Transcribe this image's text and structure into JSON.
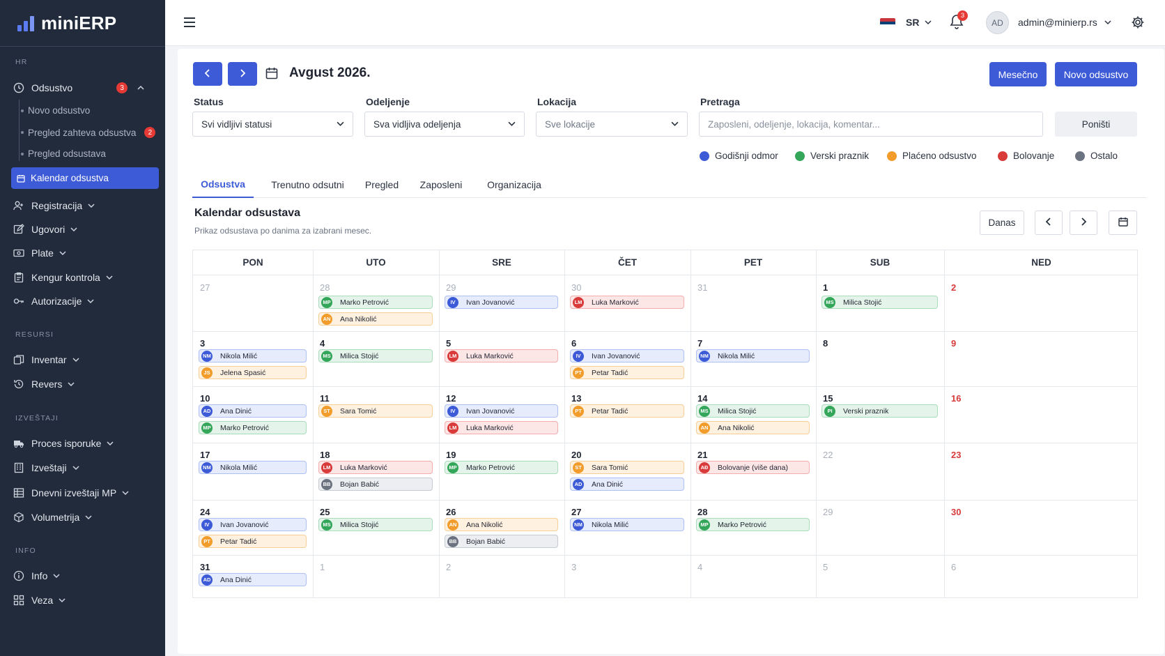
{
  "app": {
    "name": "miniERP"
  },
  "colors": {
    "accent": "#3d5ad7",
    "sidebar": "#222b3b",
    "blue": "#3d5ad7",
    "green": "#34a65a",
    "orange": "#f29d2b",
    "red": "#d93b3b",
    "gray": "#6c7380"
  },
  "sidebar": {
    "sections": {
      "hr": "HR",
      "resursi": "RESURSI",
      "izvestaji": "IZVEŠTAJI",
      "info": "INFO"
    },
    "odsustvo": {
      "label": "Odsustvo",
      "badge": "3"
    },
    "sub": {
      "novo": "Novo odsustvo",
      "pregled_zahteva": "Pregled zahteva odsustva",
      "pregled_zahteva_badge": "2",
      "pregled": "Pregled odsustava",
      "kalendar": "Kalendar odsustva"
    },
    "items": {
      "registracija": "Registracija",
      "ugovori": "Ugovori",
      "plate": "Plate",
      "kengur": "Kengur kontrola",
      "autorizacije": "Autorizacije",
      "inventar": "Inventar",
      "revers": "Revers",
      "proces": "Proces isporuke",
      "izvestaji": "Izveštaji",
      "dnevni": "Dnevni izveštaji MP",
      "volumetrija": "Volumetrija",
      "info": "Info",
      "veza": "Veza"
    }
  },
  "topbar": {
    "lang": "SR",
    "notifications": "3",
    "avatar": "AD",
    "user": "admin@minierp.rs"
  },
  "header": {
    "month": "Avgust 2026.",
    "monthly_btn": "Mesečno",
    "new_btn": "Novo odsustvo"
  },
  "filters": {
    "status": {
      "label": "Status",
      "value": "Svi vidljivi statusi"
    },
    "odeljenje": {
      "label": "Odeljenje",
      "value": "Sva vidljiva odeljenja"
    },
    "lokacija": {
      "label": "Lokacija",
      "value": "Sve lokacije"
    },
    "pretraga": {
      "label": "Pretraga",
      "placeholder": "Zaposleni, odeljenje, lokacija, komentar..."
    },
    "reset": "Poništi"
  },
  "legend": [
    {
      "label": "Godišnji odmor",
      "color": "#3d5ad7"
    },
    {
      "label": "Verski praznik",
      "color": "#34a65a"
    },
    {
      "label": "Plaćeno odsustvo",
      "color": "#f29d2b"
    },
    {
      "label": "Bolovanje",
      "color": "#d93b3b"
    },
    {
      "label": "Ostalo",
      "color": "#6c7380"
    }
  ],
  "tabs": [
    "Odsustva",
    "Trenutno odsutni",
    "Pregled",
    "Zaposleni",
    "Organizacija"
  ],
  "calendar": {
    "title": "Kalendar odsustava",
    "subtitle": "Prikaz odsustava po danima za izabrani mesec.",
    "today_btn": "Danas",
    "weekdays": [
      "PON",
      "UTO",
      "SRE",
      "ČET",
      "PET",
      "SUB",
      "NED"
    ],
    "weeks": [
      [
        {
          "day": "27",
          "muted": true,
          "events": []
        },
        {
          "day": "28",
          "muted": true,
          "events": [
            {
              "ini": "MP",
              "name": "Marko Petrović",
              "type": "green"
            },
            {
              "ini": "AN",
              "name": "Ana Nikolić",
              "type": "orange"
            }
          ]
        },
        {
          "day": "29",
          "muted": true,
          "events": [
            {
              "ini": "IV",
              "name": "Ivan Jovanović",
              "type": "blue"
            }
          ]
        },
        {
          "day": "30",
          "muted": true,
          "events": [
            {
              "ini": "LM",
              "name": "Luka Marković",
              "type": "red"
            }
          ]
        },
        {
          "day": "31",
          "muted": true,
          "events": []
        },
        {
          "day": "1",
          "muted": false,
          "events": [
            {
              "ini": "MS",
              "name": "Milica Stojić",
              "type": "green"
            }
          ]
        },
        {
          "day": "2",
          "muted": false,
          "sun": true,
          "events": []
        }
      ],
      [
        {
          "day": "3",
          "events": [
            {
              "ini": "NM",
              "name": "Nikola Milić",
              "type": "blue"
            },
            {
              "ini": "JS",
              "name": "Jelena Spasić",
              "type": "orange"
            }
          ]
        },
        {
          "day": "4",
          "events": [
            {
              "ini": "MS",
              "name": "Milica Stojić",
              "type": "green"
            }
          ]
        },
        {
          "day": "5",
          "events": [
            {
              "ini": "LM",
              "name": "Luka Marković",
              "type": "red"
            }
          ]
        },
        {
          "day": "6",
          "events": [
            {
              "ini": "IV",
              "name": "Ivan Jovanović",
              "type": "blue"
            },
            {
              "ini": "PT",
              "name": "Petar Tadić",
              "type": "orange"
            }
          ]
        },
        {
          "day": "7",
          "events": [
            {
              "ini": "NM",
              "name": "Nikola Milić",
              "type": "blue"
            }
          ]
        },
        {
          "day": "8",
          "events": []
        },
        {
          "day": "9",
          "sun": true,
          "events": []
        }
      ],
      [
        {
          "day": "10",
          "events": [
            {
              "ini": "AD",
              "name": "Ana Dinić",
              "type": "blue"
            },
            {
              "ini": "MP",
              "name": "Marko Petrović",
              "type": "green"
            }
          ]
        },
        {
          "day": "11",
          "events": [
            {
              "ini": "ST",
              "name": "Sara Tomić",
              "type": "orange"
            }
          ]
        },
        {
          "day": "12",
          "events": [
            {
              "ini": "IV",
              "name": "Ivan Jovanović",
              "type": "blue"
            },
            {
              "ini": "LM",
              "name": "Luka Marković",
              "type": "red"
            }
          ]
        },
        {
          "day": "13",
          "events": [
            {
              "ini": "PT",
              "name": "Petar Tadić",
              "type": "orange"
            }
          ]
        },
        {
          "day": "14",
          "events": [
            {
              "ini": "MS",
              "name": "Milica Stojić",
              "type": "green"
            },
            {
              "ini": "AN",
              "name": "Ana Nikolić",
              "type": "orange"
            }
          ]
        },
        {
          "day": "15",
          "events": [
            {
              "ini": "PI",
              "name": "Verski praznik",
              "type": "green"
            }
          ]
        },
        {
          "day": "16",
          "sun": true,
          "events": []
        }
      ],
      [
        {
          "day": "17",
          "events": [
            {
              "ini": "NM",
              "name": "Nikola Milić",
              "type": "blue"
            }
          ]
        },
        {
          "day": "18",
          "events": [
            {
              "ini": "LM",
              "name": "Luka Marković",
              "type": "red"
            },
            {
              "ini": "BB",
              "name": "Bojan Babić",
              "type": "gray"
            }
          ]
        },
        {
          "day": "19",
          "events": [
            {
              "ini": "MP",
              "name": "Marko Petrović",
              "type": "green"
            }
          ]
        },
        {
          "day": "20",
          "events": [
            {
              "ini": "ST",
              "name": "Sara Tomić",
              "type": "orange"
            },
            {
              "ini": "AD",
              "name": "Ana Dinić",
              "type": "blue"
            }
          ]
        },
        {
          "day": "21",
          "events": [
            {
              "ini": "AĐ",
              "name": "Bolovanje (više dana)",
              "type": "red"
            }
          ]
        },
        {
          "day": "22",
          "muted": true,
          "events": []
        },
        {
          "day": "23",
          "sun": true,
          "events": []
        }
      ],
      [
        {
          "day": "24",
          "events": [
            {
              "ini": "IV",
              "name": "Ivan Jovanović",
              "type": "blue"
            },
            {
              "ini": "PT",
              "name": "Petar Tadić",
              "type": "orange"
            }
          ]
        },
        {
          "day": "25",
          "events": [
            {
              "ini": "MS",
              "name": "Milica Stojić",
              "type": "green"
            }
          ]
        },
        {
          "day": "26",
          "events": [
            {
              "ini": "AN",
              "name": "Ana Nikolić",
              "type": "orange"
            },
            {
              "ini": "BB",
              "name": "Bojan Babić",
              "type": "gray"
            }
          ]
        },
        {
          "day": "27",
          "events": [
            {
              "ini": "NM",
              "name": "Nikola Milić",
              "type": "blue"
            }
          ]
        },
        {
          "day": "28",
          "events": [
            {
              "ini": "MP",
              "name": "Marko Petrović",
              "type": "green"
            }
          ]
        },
        {
          "day": "29",
          "muted": true,
          "events": []
        },
        {
          "day": "30",
          "sun": true,
          "events": []
        }
      ],
      [
        {
          "day": "31",
          "events": [
            {
              "ini": "AD",
              "name": "Ana Dinić",
              "type": "blue"
            }
          ]
        },
        {
          "day": "1",
          "muted": true,
          "events": []
        },
        {
          "day": "2",
          "muted": true,
          "events": []
        },
        {
          "day": "3",
          "muted": true,
          "events": []
        },
        {
          "day": "4",
          "muted": true,
          "events": []
        },
        {
          "day": "5",
          "muted": true,
          "events": []
        },
        {
          "day": "6",
          "muted": true,
          "sun": true,
          "events": []
        }
      ]
    ]
  }
}
